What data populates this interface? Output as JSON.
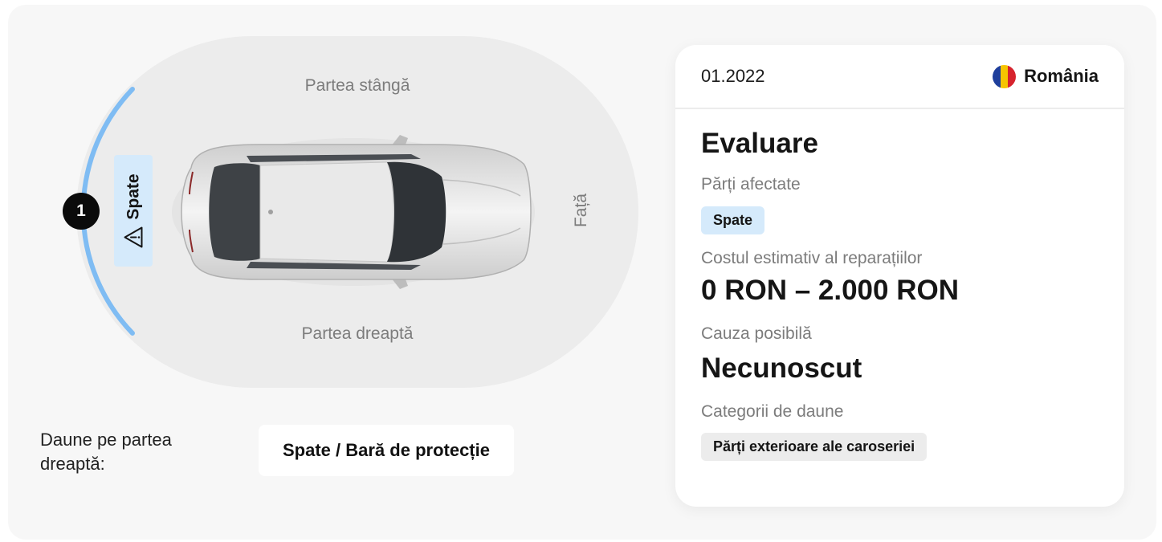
{
  "diagram": {
    "left_side_label": "Partea stângă",
    "right_side_label": "Partea dreaptă",
    "front_label": "Față",
    "rear_label": "Spate",
    "marker_number": "1",
    "accent_color": "#7fbcf3"
  },
  "damage_summary": {
    "label": "Daune pe partea dreaptă:",
    "value": "Spate / Bară de protecție"
  },
  "card": {
    "date": "01.2022",
    "country": "România",
    "title": "Evaluare",
    "affected_parts_label": "Părți afectate",
    "affected_parts": [
      "Spate"
    ],
    "cost_label": "Costul estimativ al reparațiilor",
    "cost_value": "0 RON – 2.000 RON",
    "cause_label": "Cauza posibilă",
    "cause_value": "Necunoscut",
    "categories_label": "Categorii de daune",
    "categories": [
      "Părți exterioare ale caroseriei"
    ]
  }
}
